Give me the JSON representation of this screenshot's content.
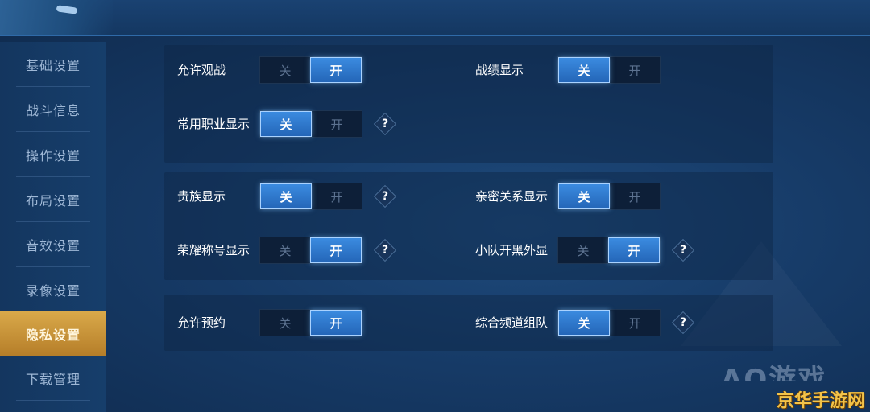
{
  "sidebar": {
    "items": [
      {
        "label": "基础设置"
      },
      {
        "label": "战斗信息"
      },
      {
        "label": "操作设置"
      },
      {
        "label": "布局设置"
      },
      {
        "label": "音效设置"
      },
      {
        "label": "录像设置"
      },
      {
        "label": "隐私设置",
        "active": true
      },
      {
        "label": "下载管理"
      }
    ]
  },
  "toggle_labels": {
    "off": "关",
    "on": "开"
  },
  "help_glyph": "?",
  "settings": [
    {
      "label": "允许观战",
      "value": "开",
      "help": false
    },
    {
      "label": "战绩显示",
      "value": "关",
      "help": false
    },
    {
      "label": "常用职业显示",
      "value": "关",
      "help": true
    },
    {
      "label": "贵族显示",
      "value": "关",
      "help": true
    },
    {
      "label": "亲密关系显示",
      "value": "关",
      "help": false
    },
    {
      "label": "荣耀称号显示",
      "value": "开",
      "help": true
    },
    {
      "label": "小队开黑外显",
      "value": "开",
      "help": true
    },
    {
      "label": "允许预约",
      "value": "开",
      "help": false
    },
    {
      "label": "综合频道组队",
      "value": "关",
      "help": true
    }
  ],
  "watermark": {
    "faint_text": "AO游戏",
    "brand_text": "京华手游网"
  },
  "colors": {
    "active_tab": "#c58f35",
    "toggle_on": "#2f79d0",
    "background": "#163a66"
  }
}
